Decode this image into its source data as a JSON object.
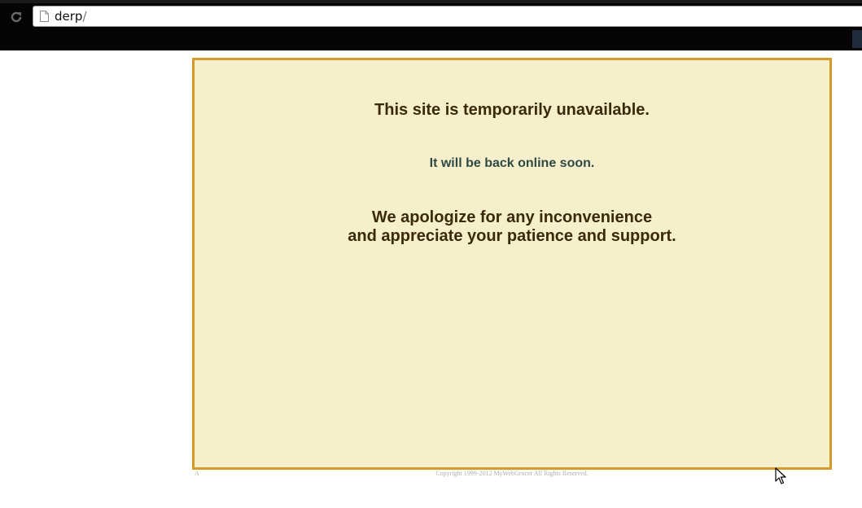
{
  "browser": {
    "url_host": "derp",
    "url_path": "/",
    "icons": {
      "reload": "reload-icon",
      "page": "page-icon"
    }
  },
  "notice": {
    "title": "This site is temporarily unavailable.",
    "subtitle": "It will be back online soon.",
    "apology_line1": "We apologize for any inconvenience",
    "apology_line2": "and appreciate your patience and support."
  },
  "footer": {
    "marker": "A",
    "copyright": "Copyright 1999-2012 MyWebGrocer All Rights Reserved."
  },
  "colors": {
    "box_background": "#f6efcb",
    "box_border": "#d69a2a",
    "heading_text": "#3a2a0a",
    "subtitle_text": "#2e4a44"
  }
}
